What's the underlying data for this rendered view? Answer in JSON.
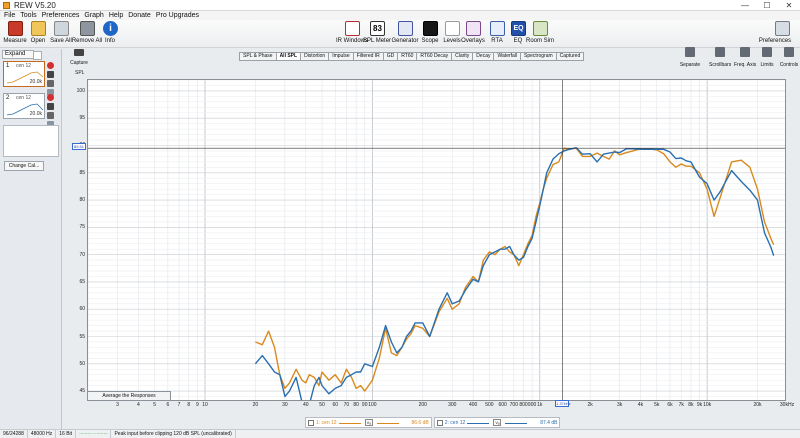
{
  "window": {
    "title": "REW V5.20",
    "min": "—",
    "max": "☐",
    "close": "✕"
  },
  "menu": [
    "File",
    "Tools",
    "Preferences",
    "Graph",
    "Help",
    "Donate",
    "Pro Upgrades"
  ],
  "toolbar": [
    {
      "label": "Measure",
      "icon": "measure-icon",
      "cls": "measure",
      "glyph": ""
    },
    {
      "label": "Open",
      "icon": "folder-icon",
      "cls": "open",
      "glyph": ""
    },
    {
      "label": "Save All",
      "icon": "save-icon",
      "cls": "save",
      "glyph": ""
    },
    {
      "label": "Remove All",
      "icon": "remove-icon",
      "cls": "remove",
      "glyph": ""
    },
    {
      "label": "Info",
      "icon": "info-icon",
      "cls": "info",
      "glyph": "i"
    }
  ],
  "toolbar_center": [
    {
      "label": "IR Windows",
      "icon": "ir-windows-icon",
      "cls": "irw",
      "glyph": ""
    },
    {
      "label": "SPL Meter",
      "icon": "spl-meter-icon",
      "cls": "spl",
      "glyph": "83"
    },
    {
      "label": "Generator",
      "icon": "generator-icon",
      "cls": "gen",
      "glyph": ""
    },
    {
      "label": "Scope",
      "icon": "scope-icon",
      "cls": "scope",
      "glyph": ""
    },
    {
      "label": "Levels",
      "icon": "levels-icon",
      "cls": "levels",
      "glyph": ""
    },
    {
      "label": "Overlays",
      "icon": "overlays-icon",
      "cls": "overlays",
      "glyph": ""
    },
    {
      "label": "RTA",
      "icon": "rta-icon",
      "cls": "rta",
      "glyph": ""
    },
    {
      "label": "EQ",
      "icon": "eq-icon",
      "cls": "eq",
      "glyph": "EQ"
    },
    {
      "label": "Room Sim",
      "icon": "room-sim-icon",
      "cls": "room",
      "glyph": ""
    }
  ],
  "preferences_label": "Preferences",
  "sidebar": {
    "expand_label": "Expand",
    "measurements": [
      {
        "num": "1",
        "name": "cen 12",
        "foot": "20.0k"
      },
      {
        "num": "2",
        "name": "cen 12",
        "foot": "20.0k"
      }
    ],
    "change_cal_label": "Change Cal..."
  },
  "capture_label": "Capture",
  "tabs": [
    "SPL & Phase",
    "All SPL",
    "Distortion",
    "Impulse",
    "Filtered IR",
    "GD",
    "RT60",
    "RT60 Decay",
    "Clarity",
    "Decay",
    "Waterfall",
    "Spectrogram",
    "Captured"
  ],
  "active_tab": 1,
  "right_tools": [
    "Separate",
    "Scrollbars",
    "Freq. Axis",
    "Limits",
    "Controls"
  ],
  "y_axis_title": "SPL",
  "cursor": {
    "y_value": "89.51",
    "x_value": "1.37kHz"
  },
  "average_button": "Average the Responses",
  "legend": [
    {
      "label": "1: cen 12",
      "vv": "Vₐ",
      "value": "86.6 dB",
      "color": "#d98a1e"
    },
    {
      "label": "2: cen 12",
      "vv": "Vₐ",
      "value": "87.4 dB",
      "color": "#2a6fb0"
    }
  ],
  "status": [
    "96/24288",
    "48000 Hz",
    "16 Bit",
    "Peak input before clipping 120 dB SPL (uncalibrated)"
  ],
  "status_meter": "·········· ··········",
  "chart_data": {
    "type": "line",
    "xscale": "log",
    "ylabel": "SPL",
    "xlim": [
      2,
      30000
    ],
    "ylim": [
      43,
      102
    ],
    "y_ticks": [
      45,
      50,
      55,
      60,
      65,
      70,
      75,
      80,
      85,
      90,
      95,
      100
    ],
    "x_ticks": [
      {
        "v": 3,
        "l": "3"
      },
      {
        "v": 4,
        "l": "4"
      },
      {
        "v": 5,
        "l": "5"
      },
      {
        "v": 6,
        "l": "6"
      },
      {
        "v": 7,
        "l": "7"
      },
      {
        "v": 8,
        "l": "8"
      },
      {
        "v": 9,
        "l": "9"
      },
      {
        "v": 10,
        "l": "10"
      },
      {
        "v": 20,
        "l": "20"
      },
      {
        "v": 30,
        "l": "30"
      },
      {
        "v": 40,
        "l": "40"
      },
      {
        "v": 50,
        "l": "50"
      },
      {
        "v": 60,
        "l": "60"
      },
      {
        "v": 70,
        "l": "70"
      },
      {
        "v": 80,
        "l": "80"
      },
      {
        "v": 90,
        "l": "90"
      },
      {
        "v": 100,
        "l": "100"
      },
      {
        "v": 200,
        "l": "200"
      },
      {
        "v": 300,
        "l": "300"
      },
      {
        "v": 400,
        "l": "400"
      },
      {
        "v": 500,
        "l": "500"
      },
      {
        "v": 600,
        "l": "600"
      },
      {
        "v": 700,
        "l": "700"
      },
      {
        "v": 800,
        "l": "800"
      },
      {
        "v": 900,
        "l": "900"
      },
      {
        "v": 1000,
        "l": "1k"
      },
      {
        "v": 2000,
        "l": "2k"
      },
      {
        "v": 3000,
        "l": "3k"
      },
      {
        "v": 4000,
        "l": "4k"
      },
      {
        "v": 5000,
        "l": "5k"
      },
      {
        "v": 6000,
        "l": "6k"
      },
      {
        "v": 7000,
        "l": "7k"
      },
      {
        "v": 8000,
        "l": "8k"
      },
      {
        "v": 9000,
        "l": "9k"
      },
      {
        "v": 10000,
        "l": "10k"
      },
      {
        "v": 20000,
        "l": "20k"
      },
      {
        "v": 30000,
        "l": "30kHz"
      }
    ],
    "cursor": {
      "x": 1370,
      "y": 89.51
    },
    "series": [
      {
        "name": "1: cen 12",
        "color": "#d98a1e",
        "x": [
          20,
          22,
          24,
          26,
          28,
          30,
          32,
          35,
          38,
          40,
          42,
          45,
          48,
          50,
          55,
          60,
          65,
          70,
          75,
          80,
          85,
          90,
          100,
          110,
          120,
          130,
          140,
          150,
          160,
          170,
          180,
          200,
          220,
          250,
          280,
          300,
          330,
          360,
          400,
          430,
          460,
          500,
          540,
          580,
          620,
          660,
          700,
          750,
          800,
          850,
          900,
          950,
          1000,
          1050,
          1100,
          1200,
          1300,
          1400,
          1500,
          1650,
          1800,
          2000,
          2200,
          2400,
          2600,
          2800,
          3000,
          3300,
          3600,
          4000,
          4500,
          5000,
          5500,
          6000,
          6500,
          7000,
          7500,
          8000,
          9000,
          10000,
          11000,
          12000,
          14000,
          16000,
          18000,
          20000,
          22000,
          24000,
          25000
        ],
        "y": [
          54,
          53.5,
          56,
          53,
          48,
          45.5,
          46.5,
          49,
          47,
          46.5,
          48,
          47.5,
          46,
          48.5,
          47,
          48,
          46.5,
          49,
          47.5,
          45.5,
          46,
          45,
          47,
          51,
          56.5,
          52,
          51.5,
          53,
          54.5,
          55.5,
          57,
          56.5,
          55,
          59.5,
          62,
          60,
          61,
          64,
          66,
          65,
          69,
          70.5,
          70,
          71,
          71.5,
          70.5,
          70,
          68,
          70,
          72,
          73.5,
          77,
          79.5,
          82,
          84,
          86.5,
          87,
          89.5,
          89.3,
          89.5,
          88,
          88,
          88.6,
          88,
          87.5,
          89,
          88.3,
          88.7,
          89,
          89.4,
          89.4,
          89.2,
          88.5,
          87,
          86,
          86.6,
          86.2,
          86.2,
          85,
          82,
          77,
          80.6,
          87,
          87.3,
          86,
          82,
          76,
          73,
          71.8
        ]
      },
      {
        "name": "2: cen 12",
        "color": "#2a6fb0",
        "x": [
          20,
          22,
          24,
          26,
          28,
          30,
          32,
          35,
          38,
          40,
          42,
          45,
          48,
          50,
          55,
          60,
          65,
          70,
          75,
          80,
          85,
          90,
          100,
          110,
          120,
          130,
          140,
          150,
          160,
          170,
          180,
          200,
          220,
          250,
          280,
          300,
          330,
          360,
          400,
          430,
          460,
          500,
          540,
          580,
          620,
          660,
          700,
          750,
          800,
          850,
          900,
          950,
          1000,
          1050,
          1100,
          1200,
          1300,
          1400,
          1500,
          1650,
          1800,
          2000,
          2200,
          2400,
          2600,
          2800,
          3000,
          3300,
          3600,
          4000,
          4500,
          5000,
          5500,
          6000,
          6500,
          7000,
          7500,
          8000,
          9000,
          10000,
          11000,
          12000,
          14000,
          16000,
          18000,
          20000,
          22000,
          24000,
          25000
        ],
        "y": [
          50,
          51.5,
          50,
          48.5,
          48,
          44,
          45,
          47.5,
          43,
          41,
          42.5,
          46,
          47.5,
          46,
          44.5,
          45.5,
          46,
          47.5,
          48,
          48.5,
          48.5,
          50,
          49.5,
          53,
          57,
          54,
          52,
          53,
          55,
          56,
          57.5,
          57.5,
          55,
          60,
          63,
          61,
          61.5,
          63.5,
          65.5,
          65,
          68,
          70,
          70.5,
          71,
          71,
          71.5,
          70,
          69,
          69.5,
          71.5,
          73,
          76,
          79,
          82,
          85,
          87.5,
          88.5,
          89,
          89.3,
          89.6,
          88.4,
          88.5,
          87,
          88.4,
          88.6,
          88.8,
          88.7,
          89.4,
          89.4,
          89.3,
          89.3,
          89.3,
          89.3,
          88.8,
          87.6,
          87.7,
          87.2,
          87,
          84.2,
          83,
          80,
          81.6,
          85.4,
          83.4,
          81.8,
          80,
          74,
          71.4,
          69.8
        ]
      }
    ]
  }
}
